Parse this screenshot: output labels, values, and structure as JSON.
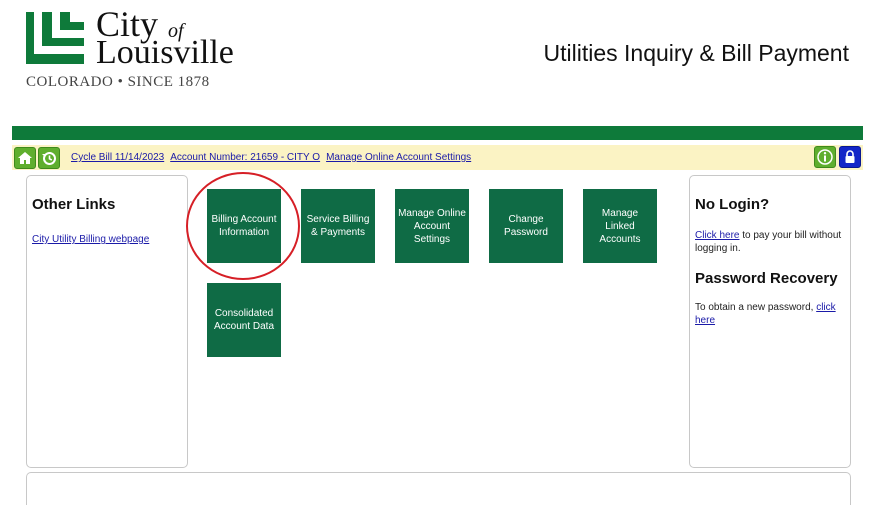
{
  "header": {
    "logo_city": "City",
    "logo_of": "of",
    "logo_louisville": "Louisville",
    "logo_sub": "COLORADO • SINCE 1878",
    "page_title": "Utilities Inquiry & Bill Payment"
  },
  "toolbar": {
    "cycle_bill": "Cycle Bill 11/14/2023",
    "account_number": "Account Number: 21659 - CITY O",
    "manage_settings": "Manage Online Account Settings"
  },
  "left_panel": {
    "title": "Other Links",
    "link": "City Utility Billing webpage"
  },
  "tiles": [
    {
      "label": "Billing Account Information"
    },
    {
      "label": "Service Billing & Payments"
    },
    {
      "label": "Manage Online Account Settings"
    },
    {
      "label": "Change Password"
    },
    {
      "label": "Manage Linked Accounts"
    },
    {
      "label": "Consolidated Account Data"
    }
  ],
  "right_panel": {
    "no_login_title": "No Login?",
    "no_login_link": "Click here",
    "no_login_text": " to pay your bill without logging in.",
    "recovery_title": "Password Recovery",
    "recovery_text": "To obtain a new password, ",
    "recovery_link": "click here"
  },
  "colors": {
    "brand_green": "#0e7a3a",
    "tile_green": "#0f6b45",
    "toolbar_bg": "#fbf3c4",
    "highlight_red": "#d61f26"
  }
}
